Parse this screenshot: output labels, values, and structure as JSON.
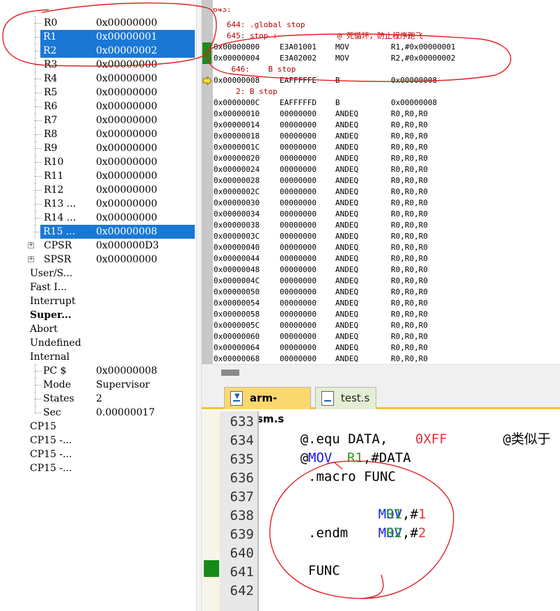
{
  "registers": {
    "rows": [
      {
        "name": "R0",
        "value": "0x00000000"
      },
      {
        "name": "R1",
        "value": "0x00000001"
      },
      {
        "name": "R2",
        "value": "0x00000002"
      },
      {
        "name": "R3",
        "value": "0x00000000"
      },
      {
        "name": "R4",
        "value": "0x00000000"
      },
      {
        "name": "R5",
        "value": "0x00000000"
      },
      {
        "name": "R6",
        "value": "0x00000000"
      },
      {
        "name": "R7",
        "value": "0x00000000"
      },
      {
        "name": "R8",
        "value": "0x00000000"
      },
      {
        "name": "R9",
        "value": "0x00000000"
      },
      {
        "name": "R10",
        "value": "0x00000000"
      },
      {
        "name": "R11",
        "value": "0x00000000"
      },
      {
        "name": "R12",
        "value": "0x00000000"
      },
      {
        "name": "R13 ...",
        "value": "0x00000000"
      },
      {
        "name": "R14 ...",
        "value": "0x00000000"
      },
      {
        "name": "R15 ...",
        "value": "0x00000008"
      }
    ],
    "cpsr": {
      "name": "CPSR",
      "value": "0x000000D3",
      "expander": "+"
    },
    "spsr": {
      "name": "SPSR",
      "value": "0x00000000",
      "expander": "+"
    },
    "modes": [
      "User/S...",
      "Fast I...",
      "Interrupt",
      "Super...",
      "Abort",
      "Undefined",
      "Internal"
    ],
    "internal": [
      {
        "name": "PC  $",
        "value": "0x00000008"
      },
      {
        "name": "Mode",
        "value": "Supervisor"
      },
      {
        "name": "States",
        "value": "2"
      },
      {
        "name": "Sec",
        "value": "0.00000017"
      }
    ],
    "cp15": [
      "CP15",
      "CP15 -...",
      "CP15 -...",
      "CP15 -..."
    ]
  },
  "disassembly": {
    "top_partial": "643:",
    "source_lines": {
      "l644": "   644: .global stop",
      "l645": "   645: stop :             @ 死循环，防止程序跑飞",
      "l646": "    646:    B stop",
      "l2": "     2: B stop"
    },
    "instructions": [
      {
        "addr": "0x00000000",
        "opcode": "E3A01001",
        "mnemonic": "MOV",
        "args": "R1,#0x00000001"
      },
      {
        "addr": "0x00000004",
        "opcode": "E3A02002",
        "mnemonic": "MOV",
        "args": "R2,#0x00000002"
      },
      {
        "addr": "0x00000008",
        "opcode": "EAFFFFFE",
        "mnemonic": "B",
        "args": "0x00000008"
      },
      {
        "addr": "0x0000000C",
        "opcode": "EAFFFFFD",
        "mnemonic": "B",
        "args": "0x00000008"
      },
      {
        "addr": "0x00000010",
        "opcode": "00000000",
        "mnemonic": "ANDEQ",
        "args": "R0,R0,R0"
      },
      {
        "addr": "0x00000014",
        "opcode": "00000000",
        "mnemonic": "ANDEQ",
        "args": "R0,R0,R0"
      },
      {
        "addr": "0x00000018",
        "opcode": "00000000",
        "mnemonic": "ANDEQ",
        "args": "R0,R0,R0"
      },
      {
        "addr": "0x0000001C",
        "opcode": "00000000",
        "mnemonic": "ANDEQ",
        "args": "R0,R0,R0"
      },
      {
        "addr": "0x00000020",
        "opcode": "00000000",
        "mnemonic": "ANDEQ",
        "args": "R0,R0,R0"
      },
      {
        "addr": "0x00000024",
        "opcode": "00000000",
        "mnemonic": "ANDEQ",
        "args": "R0,R0,R0"
      },
      {
        "addr": "0x00000028",
        "opcode": "00000000",
        "mnemonic": "ANDEQ",
        "args": "R0,R0,R0"
      },
      {
        "addr": "0x0000002C",
        "opcode": "00000000",
        "mnemonic": "ANDEQ",
        "args": "R0,R0,R0"
      },
      {
        "addr": "0x00000030",
        "opcode": "00000000",
        "mnemonic": "ANDEQ",
        "args": "R0,R0,R0"
      },
      {
        "addr": "0x00000034",
        "opcode": "00000000",
        "mnemonic": "ANDEQ",
        "args": "R0,R0,R0"
      },
      {
        "addr": "0x00000038",
        "opcode": "00000000",
        "mnemonic": "ANDEQ",
        "args": "R0,R0,R0"
      },
      {
        "addr": "0x0000003C",
        "opcode": "00000000",
        "mnemonic": "ANDEQ",
        "args": "R0,R0,R0"
      },
      {
        "addr": "0x00000040",
        "opcode": "00000000",
        "mnemonic": "ANDEQ",
        "args": "R0,R0,R0"
      },
      {
        "addr": "0x00000044",
        "opcode": "00000000",
        "mnemonic": "ANDEQ",
        "args": "R0,R0,R0"
      },
      {
        "addr": "0x00000048",
        "opcode": "00000000",
        "mnemonic": "ANDEQ",
        "args": "R0,R0,R0"
      },
      {
        "addr": "0x0000004C",
        "opcode": "00000000",
        "mnemonic": "ANDEQ",
        "args": "R0,R0,R0"
      },
      {
        "addr": "0x00000050",
        "opcode": "00000000",
        "mnemonic": "ANDEQ",
        "args": "R0,R0,R0"
      },
      {
        "addr": "0x00000054",
        "opcode": "00000000",
        "mnemonic": "ANDEQ",
        "args": "R0,R0,R0"
      },
      {
        "addr": "0x00000058",
        "opcode": "00000000",
        "mnemonic": "ANDEQ",
        "args": "R0,R0,R0"
      },
      {
        "addr": "0x0000005C",
        "opcode": "00000000",
        "mnemonic": "ANDEQ",
        "args": "R0,R0,R0"
      },
      {
        "addr": "0x00000060",
        "opcode": "00000000",
        "mnemonic": "ANDEQ",
        "args": "R0,R0,R0"
      },
      {
        "addr": "0x00000064",
        "opcode": "00000000",
        "mnemonic": "ANDEQ",
        "args": "R0,R0,R0"
      },
      {
        "addr": "0x00000068",
        "opcode": "00000000",
        "mnemonic": "ANDEQ",
        "args": "R0,R0,R0"
      }
    ]
  },
  "editor": {
    "tabs": [
      {
        "label": "arm-asm.s",
        "active": true
      },
      {
        "label": "test.s",
        "active": false
      }
    ],
    "line_numbers": [
      "633",
      "634",
      "635",
      "636",
      "637",
      "638",
      "639",
      "640",
      "641",
      "642"
    ],
    "lines": {
      "l633": {
        "comment": "@",
        "directive": ".equ DATA,",
        "value": "0XFF",
        "trailing": "@类似于"
      },
      "l634": {
        "comment": "@",
        "mnemonic": "MOV",
        "reg": "R1",
        "rest": ",#DATA"
      },
      "l636": {
        "text": ".macro FUNC"
      },
      "l637": {
        "mnemonic": "MOV",
        "reg": "R1",
        "sep": ",#",
        "imm": "1"
      },
      "l638": {
        "mnemonic": "MOV",
        "reg": "R2",
        "sep": ",#",
        "imm": "2"
      },
      "l639": {
        "text": ".endm"
      },
      "l641": {
        "text": "FUNC"
      }
    }
  },
  "colors": {
    "selection": "#1a78d4",
    "breakpoint": "#168a16",
    "annotation": "#e02020",
    "tab_active": "#fbd86e",
    "tab_inactive": "#e3eed2"
  }
}
